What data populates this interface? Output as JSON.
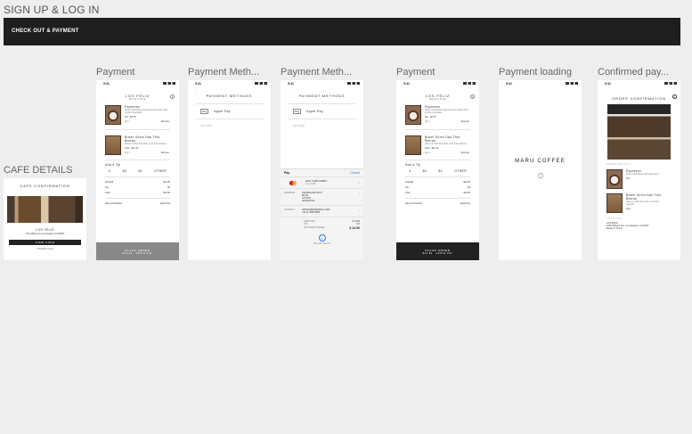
{
  "section_title": "SIGN UP & LOG IN",
  "banner": "CHECK OUT & PAYMENT",
  "cafe_label": "CAFE DETAILS",
  "frame_labels": {
    "payment1": "Payment",
    "methods1": "Payment Meth...",
    "methods2": "Payment Meth...",
    "payment2": "Payment",
    "loading": "Payment loading",
    "confirmed": "Confirmed pay..."
  },
  "status_time": "9:41",
  "cafe": {
    "header": "CAFE CONFIRMATION",
    "name": "LOS FELIZ",
    "address": "(The Office) Los Los Angeles CA 90027",
    "cta": "VIEW CAFE",
    "link": "CHANGE CAFE"
  },
  "payment": {
    "title": "LOS FELIZ",
    "subtitle": "Pick up in 15 min",
    "items": [
      {
        "name": "Espresso",
        "desc": "Deep, full-bodied espresso blend with notes of dark chocolate",
        "meta": "Hot",
        "price": "$3.75",
        "qty": "Qty 1",
        "remove": "Remove"
      },
      {
        "name": "Brazil Serra Das Tres Barras",
        "desc": "Notes of milk chocolate, nuts and caramel",
        "meta": "12oz",
        "price": "$11.15",
        "qty": "Qty 1",
        "remove": "Remove"
      }
    ],
    "tip_label": "Add a Tip",
    "tips": [
      "0",
      "$0",
      "$1",
      "OTHER"
    ],
    "subtotal_label": "Subtotal",
    "subtotal": "$14.90",
    "tax_label": "Tax",
    "tax": "$0",
    "total_label": "Total",
    "total": "$14.90",
    "method_label": "Payment Method",
    "method_value": "Apple Pay",
    "place_order": "PLACE ORDER",
    "place_order_sub": "$14.90 · APPLE PAY"
  },
  "methods": {
    "header": "PAYMENT METHODS",
    "apple_pay": "Apple Pay",
    "add_card": "ADD CARD"
  },
  "applepay_sheet": {
    "brand": "Pay",
    "cancel": "Cancel",
    "card_name": "EASY CARD CREDIT",
    "card_sub": "(••••) 1234",
    "shipping_label": "ADDRESS",
    "shipping_lines": [
      "AVENIDA DE MAYO",
      "BS AS",
      "CP 1004",
      "ARGENTINA"
    ],
    "contact_label": "CONTACT",
    "contact_lines": [
      "APPLESEED@EMAIL.COM",
      "+54 11 5555-5555"
    ],
    "subtotal_label": "SUBTOTAL",
    "subtotal": "$ 14.90",
    "tax_label": "TAX",
    "tax": "$ 0",
    "pay_label": "PAY MARU COFFEE",
    "pay_total": "$ 14.90",
    "confirm": "Pay with Face ID"
  },
  "loading": {
    "brand": "MARU COFFEE"
  },
  "confirmed": {
    "header": "ORDER CONFIRMATION",
    "details_label": "ORDER DETAILS",
    "items": [
      {
        "name": "Espresso",
        "desc": "Deep, full-bodied espresso blend",
        "meta": "Hot"
      },
      {
        "name": "Brazil Serra Das Tres Barras",
        "desc": "Notes of milk chocolate, nuts and caramel",
        "meta": "12oz"
      }
    ],
    "location_label": "LOCATION",
    "location_name": "LOS FELIZ",
    "location_address": "1936 Hillhurst Ave, Los Angeles, CA 90027",
    "pickup": "Ready in 15 min"
  }
}
